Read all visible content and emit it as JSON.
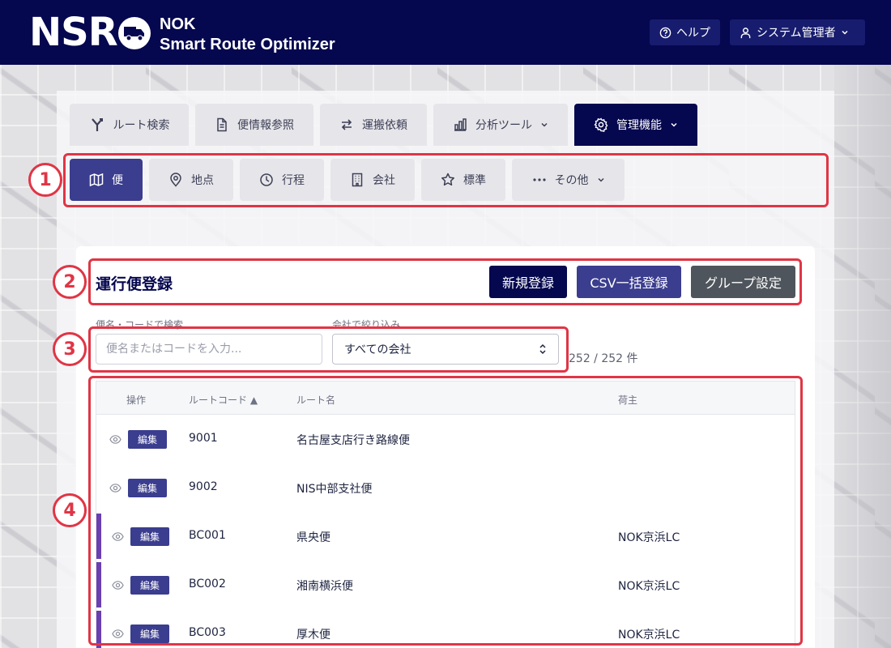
{
  "header": {
    "logo_text": "NSRO",
    "brand_line1": "NOK",
    "brand_line2": "Smart Route Optimizer",
    "help_label": "ヘルプ",
    "user_label": "システム管理者"
  },
  "main_tabs": [
    {
      "label": "ルート検索",
      "icon": "route-icon"
    },
    {
      "label": "便情報参照",
      "icon": "document-icon"
    },
    {
      "label": "運搬依頼",
      "icon": "swap-icon"
    },
    {
      "label": "分析ツール",
      "icon": "bar-chart-icon"
    },
    {
      "label": "管理機能",
      "icon": "gear-icon",
      "active": true
    }
  ],
  "sub_tabs": [
    {
      "label": "便",
      "icon": "map-icon",
      "active": true
    },
    {
      "label": "地点",
      "icon": "pin-icon"
    },
    {
      "label": "行程",
      "icon": "clock-icon"
    },
    {
      "label": "会社",
      "icon": "building-icon"
    },
    {
      "label": "標準",
      "icon": "star-icon"
    },
    {
      "label": "その他",
      "icon": "dots-icon"
    }
  ],
  "page": {
    "title": "運行便登録",
    "new_button": "新規登録",
    "csv_button": "CSV一括登録",
    "group_button": "グループ設定"
  },
  "filters": {
    "search_label": "便名・コードで検索",
    "search_placeholder": "便名またはコードを入力...",
    "company_label": "会社で絞り込み",
    "company_selected": "すべての会社",
    "count_text": "252 / 252 件"
  },
  "table": {
    "headers": {
      "ops": "操作",
      "code": "ルートコード ▲",
      "name": "ルート名",
      "owner": "荷主"
    },
    "edit_label": "編集",
    "rows": [
      {
        "code": "9001",
        "name": "名古屋支店行き路線便",
        "owner": ""
      },
      {
        "code": "9002",
        "name": "NIS中部支社便",
        "owner": ""
      },
      {
        "code": "BC001",
        "name": "県央便",
        "owner": "NOK京浜LC"
      },
      {
        "code": "BC002",
        "name": "湘南横浜便",
        "owner": "NOK京浜LC"
      },
      {
        "code": "BC003",
        "name": "厚木便",
        "owner": "NOK京浜LC"
      }
    ]
  },
  "annotations": [
    "1",
    "2",
    "3",
    "4"
  ],
  "colors": {
    "navy": "#05074f",
    "indigo": "#3b3d8f",
    "gray_button": "#4f555c",
    "annotation_red": "#e03545",
    "row_accent": "#6a3fb0"
  }
}
